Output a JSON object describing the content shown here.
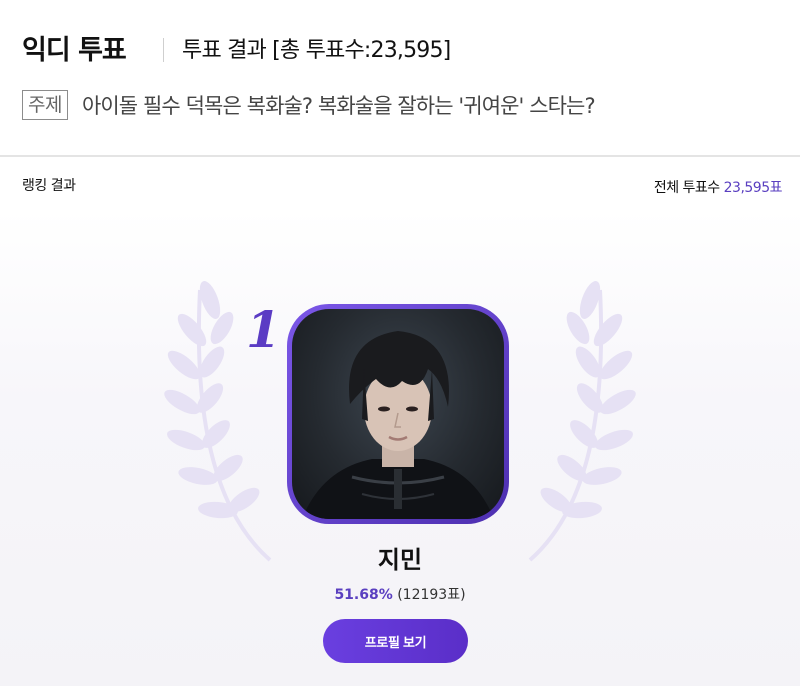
{
  "header": {
    "brand": "익디 투표",
    "result_title": "투표 결과 [총 투표수:23,595]",
    "topic_badge": "주제",
    "topic_text": "아이돌 필수 덕목은 복화술? 복화술을 잘하는 '귀여운' 스타는?"
  },
  "ranking": {
    "label": "랭킹 결과",
    "total_label": "전체 투표수",
    "total_value": "23,595표"
  },
  "winner": {
    "rank": "1",
    "name": "지민",
    "percent": "51.68%",
    "votes": "(12193표)",
    "profile_button": "프로필 보기"
  },
  "colors": {
    "accent": "#5a3fc0",
    "frame": "#6a45d8",
    "wreath": "#e3def3"
  }
}
